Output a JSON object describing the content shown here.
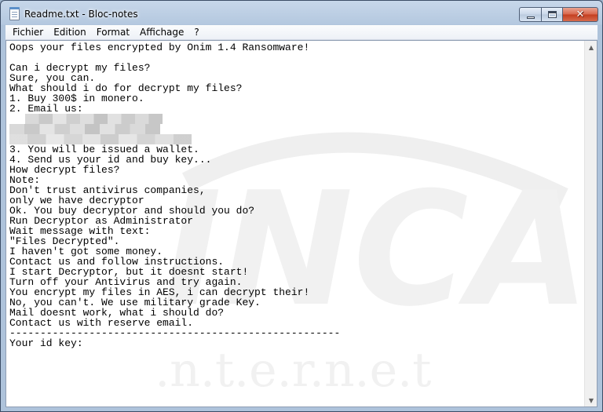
{
  "window": {
    "title": "Readme.txt - Bloc-notes"
  },
  "menu": {
    "items": [
      "Fichier",
      "Edition",
      "Format",
      "Affichage",
      "?"
    ]
  },
  "document": {
    "lines": [
      "Oops your files encrypted by Onim 1.4 Ransomware!",
      "",
      "Can i decrypt my files?",
      "Sure, you can.",
      "What should i do for decrypt my files?",
      "1. Buy 300$ in monero.",
      "2. Email us:",
      "[redacted]",
      "[redacted]",
      "[redacted]",
      "3. You will be issued a wallet.",
      "4. Send us your id and buy key...",
      "How decrypt files?",
      "Note:",
      "Don't trust antivirus companies,",
      "only we have decryptor",
      "Ok. You buy decryptor and should you do?",
      "Run Decryptor as Administrator",
      "Wait message with text:",
      "\"Files Decrypted\".",
      "I haven't got some money.",
      "Contact us and follow instructions.",
      "I start Decryptor, but it doesnt start!",
      "Turn off your Antivirus and try again.",
      "You encrypt my files in AES, i can decrypt their!",
      "No, you can't. We use military grade Key.",
      "Mail doesnt work, what i should do?",
      "Contact us with reserve email.",
      "------------------------------------------------------",
      "Your id key:"
    ]
  },
  "watermark": {
    "text_large": "INCA",
    "text_small": "i.n.t.e.r.n.e.t"
  },
  "icons": {
    "app": "notepad-icon",
    "minimize": "minimize-icon",
    "maximize": "maximize-icon",
    "close": "close-icon",
    "scroll_up": "arrow-up-icon",
    "scroll_down": "arrow-down-icon"
  },
  "colors": {
    "close_button": "#c33d1f",
    "frame": "#aec3db"
  }
}
